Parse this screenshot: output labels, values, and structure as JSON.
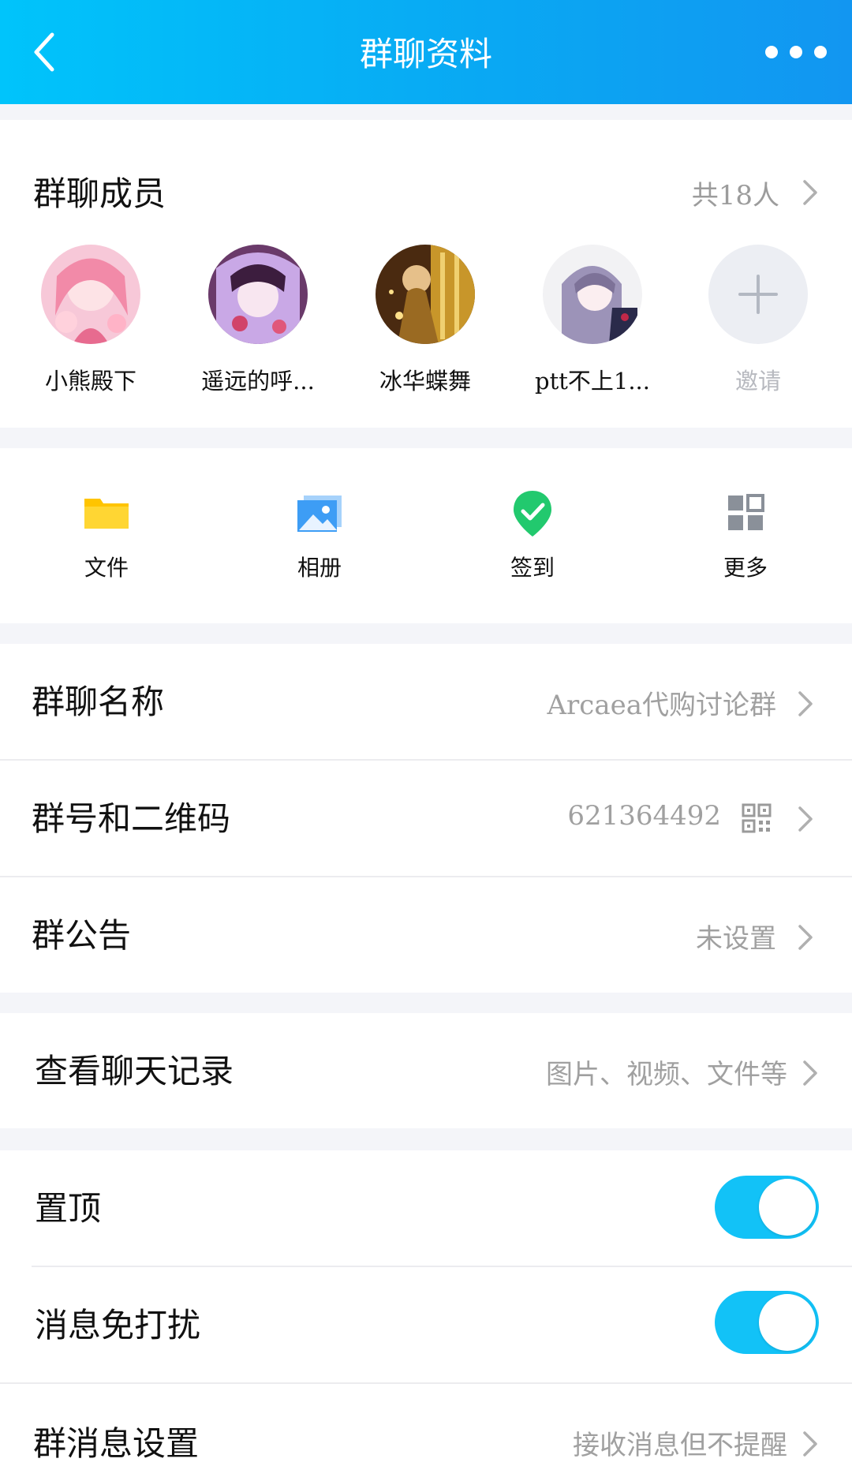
{
  "header": {
    "title": "群聊资料"
  },
  "members": {
    "title": "群聊成员",
    "count_text": "共18人",
    "list": [
      {
        "name": "小熊殿下"
      },
      {
        "name": "遥远的呼..."
      },
      {
        "name": "冰华蝶舞"
      },
      {
        "name": "ptt不上1..."
      }
    ],
    "invite_label": "邀请"
  },
  "shortcuts": [
    {
      "label": "文件",
      "icon": "folder-icon",
      "color": "#ffc400"
    },
    {
      "label": "相册",
      "icon": "photo-album-icon",
      "color": "#3d9df5"
    },
    {
      "label": "签到",
      "icon": "check-in-icon",
      "color": "#22c96e"
    },
    {
      "label": "更多",
      "icon": "grid-more-icon",
      "color": "#8a9099"
    }
  ],
  "info": {
    "group_name_label": "群聊名称",
    "group_name_value": "Arcaea代购讨论群",
    "group_id_label": "群号和二维码",
    "group_id_value": "621364492",
    "notice_label": "群公告",
    "notice_value": "未设置"
  },
  "history": {
    "label": "查看聊天记录",
    "value": "图片、视频、文件等"
  },
  "settings": {
    "pin_label": "置顶",
    "pin_on": true,
    "mute_label": "消息免打扰",
    "mute_on": true,
    "msg_setting_label": "群消息设置",
    "msg_setting_value": "接收消息但不提醒"
  },
  "colors": {
    "accent": "#12c2f7",
    "header_start": "#00c4fb",
    "header_end": "#1296f1"
  }
}
